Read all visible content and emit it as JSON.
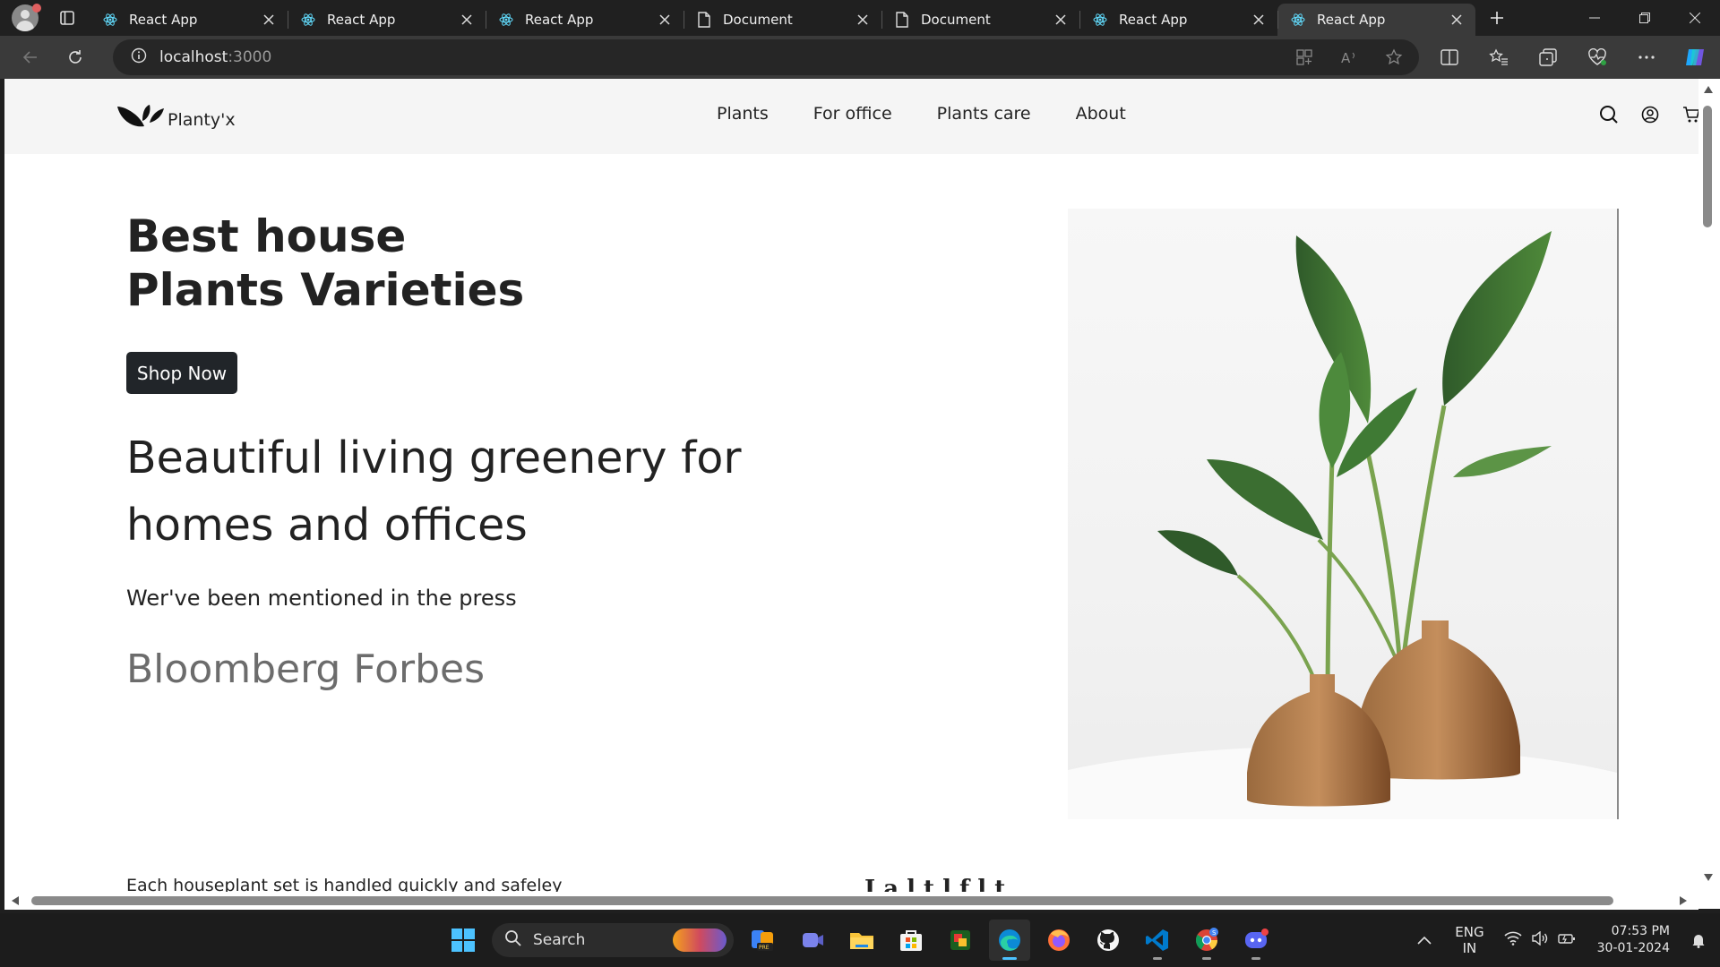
{
  "browser": {
    "tabs": [
      {
        "label": "React App",
        "icon": "react-icon",
        "active": false
      },
      {
        "label": "React App",
        "icon": "react-icon",
        "active": false
      },
      {
        "label": "React App",
        "icon": "react-icon",
        "active": false
      },
      {
        "label": "Document",
        "icon": "document-icon",
        "active": false
      },
      {
        "label": "Document",
        "icon": "document-icon",
        "active": false
      },
      {
        "label": "React App",
        "icon": "react-icon",
        "active": false
      },
      {
        "label": "React App",
        "icon": "react-icon",
        "active": true
      }
    ],
    "address": {
      "host": "localhost",
      "port": ":3000"
    }
  },
  "site": {
    "brand": "Planty'x",
    "nav": [
      "Plants",
      "For office",
      "Plants care",
      "About"
    ],
    "hero": {
      "title_line1": "Best house",
      "title_line2": "Plants Varieties",
      "cta": "Shop Now",
      "tagline": "Beautiful living greenery for homes and offices",
      "press_text": "Wer've been mentioned in the press",
      "press_names": "Bloomberg Forbes"
    },
    "below_fold": {
      "left_text": "Each houseplant set is handled quickly and safeley",
      "right_text": "I a l t l f l t"
    }
  },
  "taskbar": {
    "search_label": "Search",
    "language_line1": "ENG",
    "language_line2": "IN",
    "time": "07:53 PM",
    "date": "30-01-2024",
    "apps": [
      "copilot-icon",
      "teams-icon",
      "file-explorer-icon",
      "store-icon",
      "camtasia-icon",
      "edge-icon",
      "firefox-icon",
      "github-icon",
      "vscode-icon",
      "chrome-icon",
      "discord-icon"
    ]
  },
  "colors": {
    "button_dark": "#212529",
    "header_bg": "#f5f5f5",
    "press_gray": "#6c6c6c",
    "accent_blue": "#4cc2ff"
  }
}
